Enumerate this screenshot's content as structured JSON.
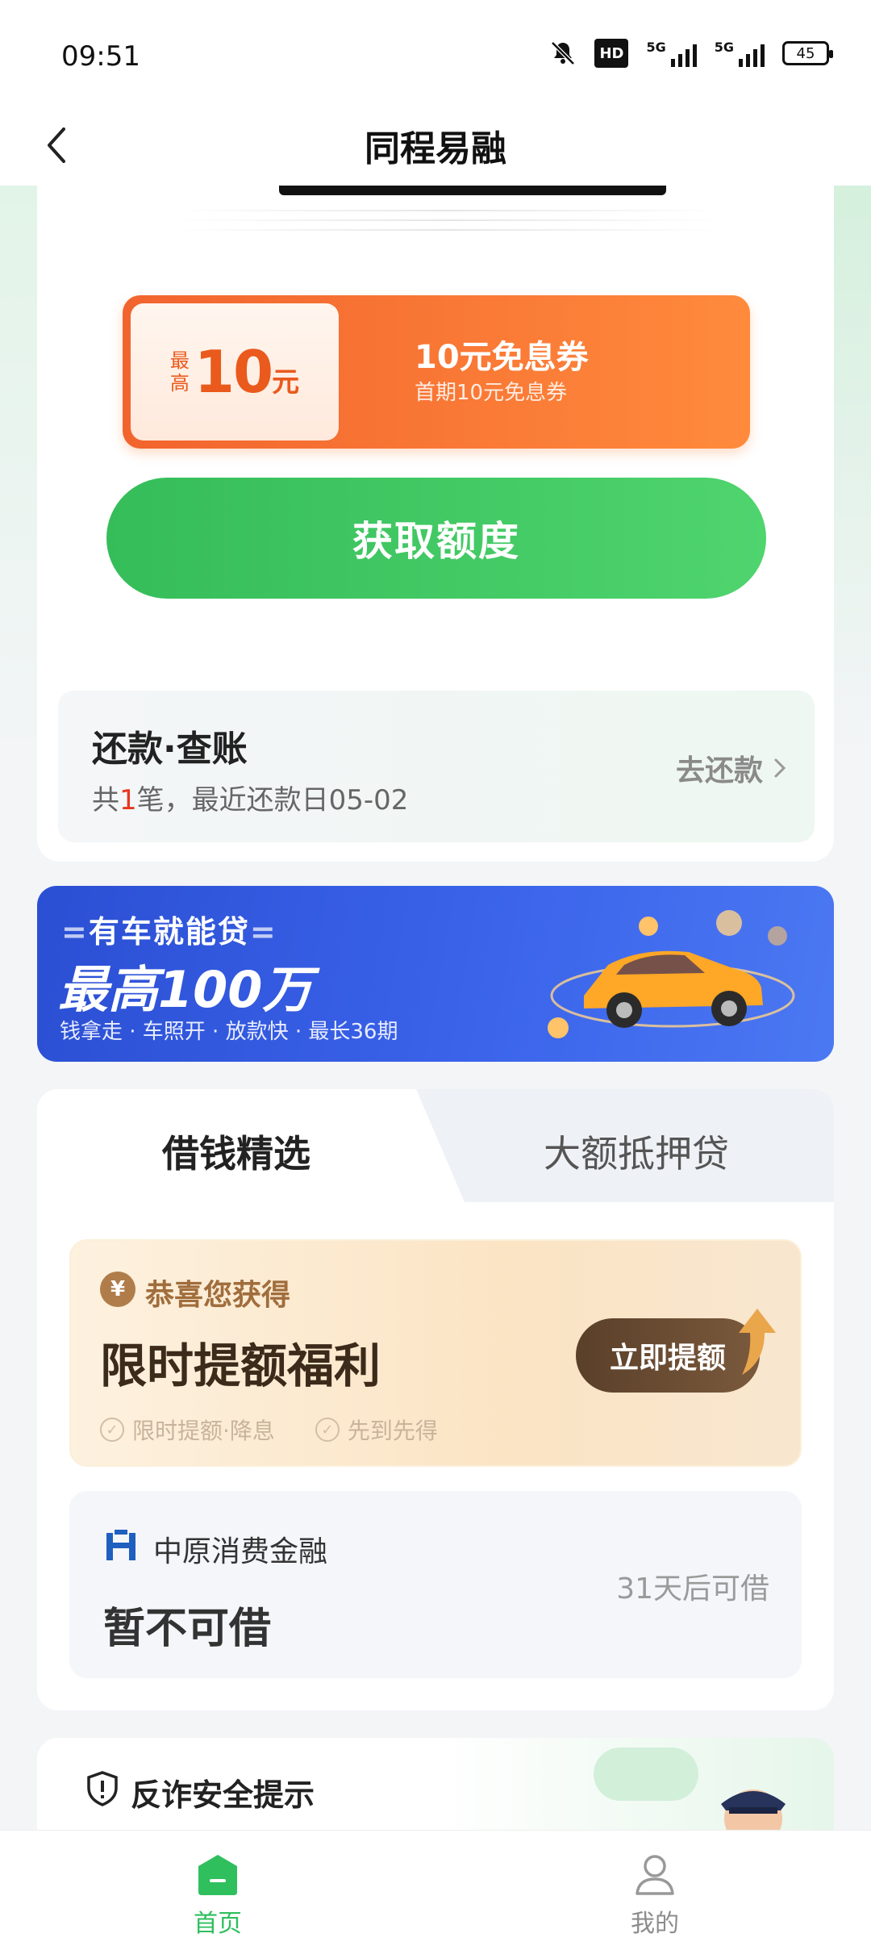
{
  "status_bar": {
    "time": "09:51",
    "hd_label": "HD",
    "sig1_label": "5G",
    "sig2_label": "5G",
    "battery": "45"
  },
  "nav": {
    "title": "同程易融"
  },
  "coupon": {
    "prefix_top": "最",
    "prefix_bottom": "高",
    "amount": "10",
    "unit": "元",
    "title": "10元免息券",
    "subtitle": "首期10元免息券"
  },
  "cta": {
    "label": "获取额度"
  },
  "repay": {
    "title": "还款·查账",
    "sub_prefix": "共",
    "count": "1",
    "sub_suffix": "笔，最近还款日05-02",
    "link_label": "去还款"
  },
  "banner": {
    "headline": "有车就能贷",
    "main": "最高100万",
    "tags": "钱拿走 · 车照开 · 放款快 · 最长36期"
  },
  "products": {
    "tab_active": "借钱精选",
    "tab_inactive": "大额抵押贷",
    "promo": {
      "badge_symbol": "¥",
      "badge_text": "恭喜您获得",
      "title": "限时提额福利",
      "checks": [
        "限时提额·降息",
        "先到先得"
      ],
      "button": "立即提额"
    },
    "lender": {
      "name": "中原消费金融",
      "status": "暂不可借",
      "note": "31天后可借"
    }
  },
  "fraud": {
    "title": "反诈安全提示"
  },
  "tabbar": {
    "home": "首页",
    "me": "我的"
  },
  "colors": {
    "brand_green": "#2fbf5d",
    "coupon_orange": "#ff8a3c",
    "banner_blue": "#3a63ea",
    "promo_brown": "#5a3f29"
  }
}
